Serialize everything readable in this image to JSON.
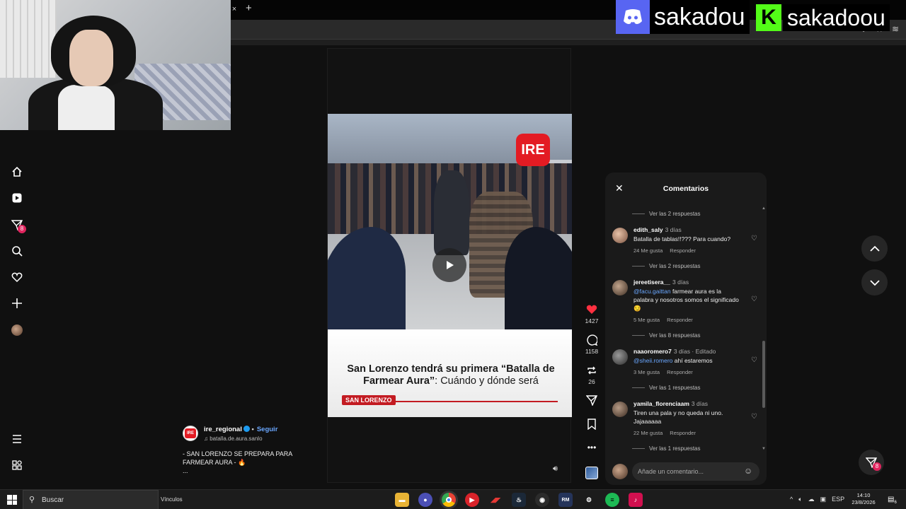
{
  "overlay": {
    "discord_name": "sakadou",
    "kick_name": "sakadoou",
    "discord_color": "#5865f2",
    "kick_color": "#53fc18"
  },
  "browser": {
    "tab_close": "×",
    "new_tab": "+"
  },
  "nav": {
    "notif_count": "8"
  },
  "video": {
    "ire_logo": "IRE",
    "headline_bold": "San Lorenzo tendrá su primera “Batalla de Farmear Aura”",
    "headline_light": ": Cuándo y dónde será",
    "tag": "SAN LORENZO"
  },
  "actions": {
    "likes": "1427",
    "comments": "1158",
    "reposts": "26"
  },
  "caption": {
    "user": "ire_regional",
    "follow": "Seguir",
    "audio": "batalla.de.aura.sanlo",
    "text": "- SAN LORENZO SE PREPARA PARA FARMEAR AURA - 🔥",
    "more": "..."
  },
  "comments_panel": {
    "title": "Comentarios",
    "input_placeholder": "Añade un comentario...",
    "like_label": "Me gusta",
    "reply_label": "Responder",
    "replies": [
      "Ver las 2 respuestas",
      "Ver las 2 respuestas",
      "Ver las 8 respuestas",
      "Ver las 1 respuestas",
      "Ver las 1 respuestas"
    ],
    "items": [
      {
        "user": "edith_saly",
        "meta": "3 días",
        "text": "Batalla de tablas!!??? Para cuando?",
        "likes": "24 Me gusta",
        "reply": "Responder"
      },
      {
        "user": "jereetisera__",
        "meta": "3 días",
        "mention": "@facu.gaittan",
        "text": " farmear aura es la palabra y nosotros somos el significado 😏",
        "likes": "5 Me gusta",
        "reply": "Responder"
      },
      {
        "user": "naaoromero7",
        "meta": "3 días · Editado",
        "mention": "@sheii.romero",
        "text": " ahí estaremos",
        "likes": "3 Me gusta",
        "reply": "Responder"
      },
      {
        "user": "yamila_florenciaam",
        "meta": "3 días",
        "text": "Tiren una pala y no queda ni uno. Jajaaaaaa",
        "likes": "22 Me gusta",
        "reply": "Responder"
      }
    ]
  },
  "inbox": {
    "count": "8"
  },
  "taskbar": {
    "search_label": "Buscar",
    "links_label": "Vínculos",
    "lang": "ESP",
    "time": "14:10",
    "date": "23/8/2026",
    "notif_count": "6"
  }
}
